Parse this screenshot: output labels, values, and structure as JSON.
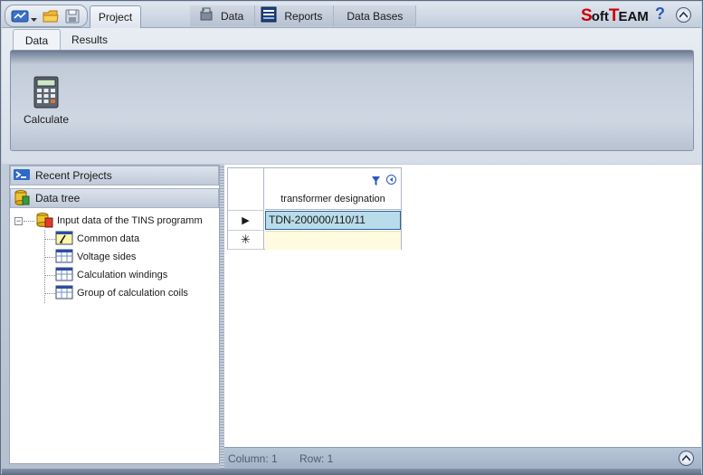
{
  "app": {
    "tab_project": "Project",
    "logo_big_s": "S",
    "logo_oft": "oft",
    "logo_big_t": "T",
    "logo_eam": "EAM",
    "help": "?"
  },
  "module_tabs": [
    {
      "label": "Data",
      "icon": "data-icon"
    },
    {
      "label": "Reports",
      "icon": "reports-icon"
    },
    {
      "label": "Data Bases",
      "icon": ""
    }
  ],
  "ribbon": {
    "tabs": [
      "Data",
      "Results"
    ],
    "active_tab": "Data",
    "buttons": [
      {
        "label": "Calculate",
        "icon": "calculator-icon"
      }
    ]
  },
  "left_pane": {
    "recent_projects": "Recent Projects",
    "data_tree": "Data tree",
    "tree": {
      "root": "Input data of the TINS programm",
      "children": [
        "Common data",
        "Voltage sides",
        "Calculation windings",
        "Group of calculation coils"
      ]
    }
  },
  "grid": {
    "column_header": "transformer designation",
    "rows": [
      "TDN-200000/110/11"
    ],
    "new_row_marker": "✳",
    "current_row_marker": "▶"
  },
  "status": {
    "column": "Column: 1",
    "row": "Row: 1"
  },
  "colors": {
    "accent_blue": "#2a5bb8",
    "logo_red": "#cc0000",
    "selected_cell": "#b9dcea"
  }
}
